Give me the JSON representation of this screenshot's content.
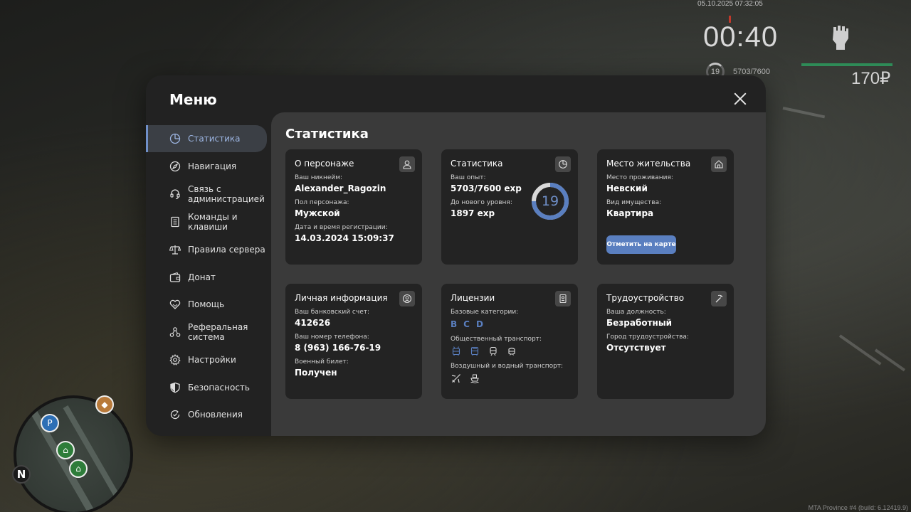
{
  "hud": {
    "datetime": "05.10.2025 07:32:05",
    "timer": "00:40",
    "level": "19",
    "exp": "5703/7600",
    "money": "170₽",
    "build": "MTA Province #4 (build: 6.12419.9)"
  },
  "menu": {
    "title": "Меню",
    "nav": [
      {
        "label": "Статистика",
        "icon": "pie-chart-icon"
      },
      {
        "label": "Навигация",
        "icon": "compass-icon"
      },
      {
        "label": "Связь с администрацией",
        "icon": "headset-icon"
      },
      {
        "label": "Команды и клавиши",
        "icon": "document-icon"
      },
      {
        "label": "Правила сервера",
        "icon": "scales-icon"
      },
      {
        "label": "Донат",
        "icon": "wallet-icon"
      },
      {
        "label": "Помощь",
        "icon": "handshake-heart-icon"
      },
      {
        "label": "Реферальная система",
        "icon": "network-icon"
      },
      {
        "label": "Настройки",
        "icon": "gear-icon"
      },
      {
        "label": "Безопасность",
        "icon": "shield-icon"
      },
      {
        "label": "Обновления",
        "icon": "refresh-check-icon"
      }
    ]
  },
  "content": {
    "title": "Статистика",
    "character": {
      "title": "О персонаже",
      "nickname_label": "Ваш никнейм:",
      "nickname": "Alexander_Ragozin",
      "gender_label": "Пол персонажа:",
      "gender": "Мужской",
      "reg_label": "Дата и время регистрации:",
      "reg": "14.03.2024 15:09:37"
    },
    "stats": {
      "title": "Статистика",
      "exp_label": "Ваш опыт:",
      "exp": "5703/7600 exp",
      "next_label": "До нового уровня:",
      "next": "1897 exp",
      "level": "19",
      "progress": 0.75
    },
    "residence": {
      "title": "Место жительства",
      "place_label": "Место проживания:",
      "place": "Невский",
      "property_label": "Вид имущества:",
      "property": "Квартира",
      "button": "Отметить на карте"
    },
    "personal": {
      "title": "Личная информация",
      "bank_label": "Ваш банковский счет:",
      "bank": "412626",
      "phone_label": "Ваш номер телефона:",
      "phone": "8 (963) 166-76-19",
      "military_label": "Военный билет:",
      "military": "Получен"
    },
    "licenses": {
      "title": "Лицензии",
      "base_label": "Базовые категории:",
      "categories": [
        "B",
        "C",
        "D"
      ],
      "public_label": "Общественный транспорт:",
      "air_label": "Воздушный и водный транспорт:"
    },
    "employment": {
      "title": "Трудоустройство",
      "position_label": "Ваша должность:",
      "position": "Безработный",
      "city_label": "Город трудоустройства:",
      "city": "Отсутствует"
    }
  },
  "colors": {
    "accent": "#5a7fc0",
    "accent_light": "#9db6e3",
    "panel": "#222222",
    "content": "#3a3a3a",
    "card": "#232323"
  }
}
